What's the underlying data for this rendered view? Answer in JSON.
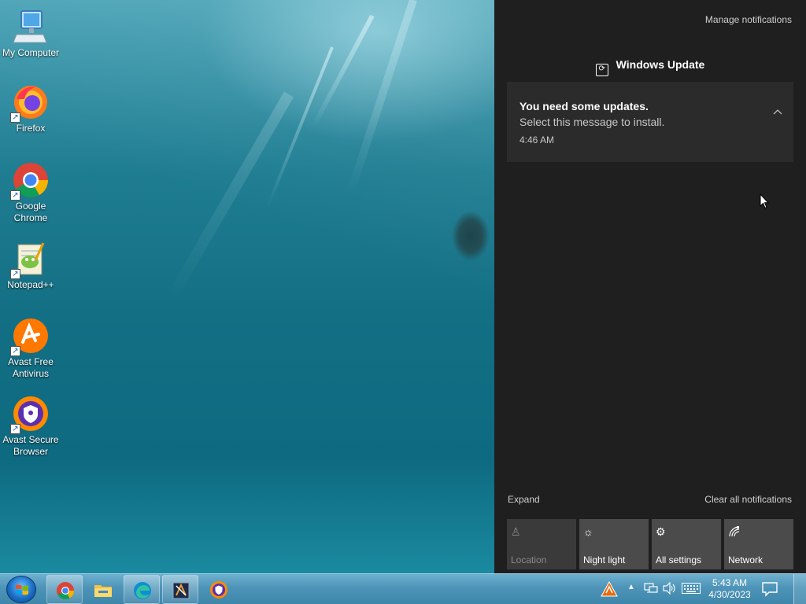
{
  "desktop": {
    "icons": [
      {
        "label": "My Computer",
        "icon": "computer-icon"
      },
      {
        "label": "Firefox",
        "icon": "firefox-icon"
      },
      {
        "label": "Google Chrome",
        "icon": "chrome-icon"
      },
      {
        "label": "Notepad++",
        "icon": "notepadpp-icon"
      },
      {
        "label": "Avast Free Antivirus",
        "icon": "avast-antivirus-icon"
      },
      {
        "label": "Avast Secure Browser",
        "icon": "avast-browser-icon"
      }
    ]
  },
  "action_center": {
    "manage_label": "Manage notifications",
    "group_title": "Windows Update",
    "notification": {
      "title": "You need some updates.",
      "body": "Select this message to install.",
      "time": "4:46 AM"
    },
    "expand_label": "Expand",
    "clear_all_label": "Clear all notifications",
    "quick_actions": [
      {
        "label": "Location",
        "icon": "location-icon",
        "enabled": false
      },
      {
        "label": "Night light",
        "icon": "night-light-icon",
        "enabled": true
      },
      {
        "label": "All settings",
        "icon": "gear-icon",
        "enabled": true
      },
      {
        "label": "Network",
        "icon": "network-icon",
        "enabled": true
      }
    ],
    "colors": {
      "panel": "#1f1f1f",
      "card": "#2b2b2b",
      "tile": "#4b4b4b"
    }
  },
  "taskbar": {
    "clock_time": "5:43 AM",
    "clock_date": "4/30/2023",
    "apps": [
      "chrome-icon",
      "file-explorer-icon",
      "edge-icon",
      "app-icon",
      "avast-browser-icon"
    ],
    "tray_icons": [
      "avast-tray-icon",
      "chevron-up-icon",
      "network-icon",
      "volume-icon",
      "keyboard-icon"
    ]
  }
}
